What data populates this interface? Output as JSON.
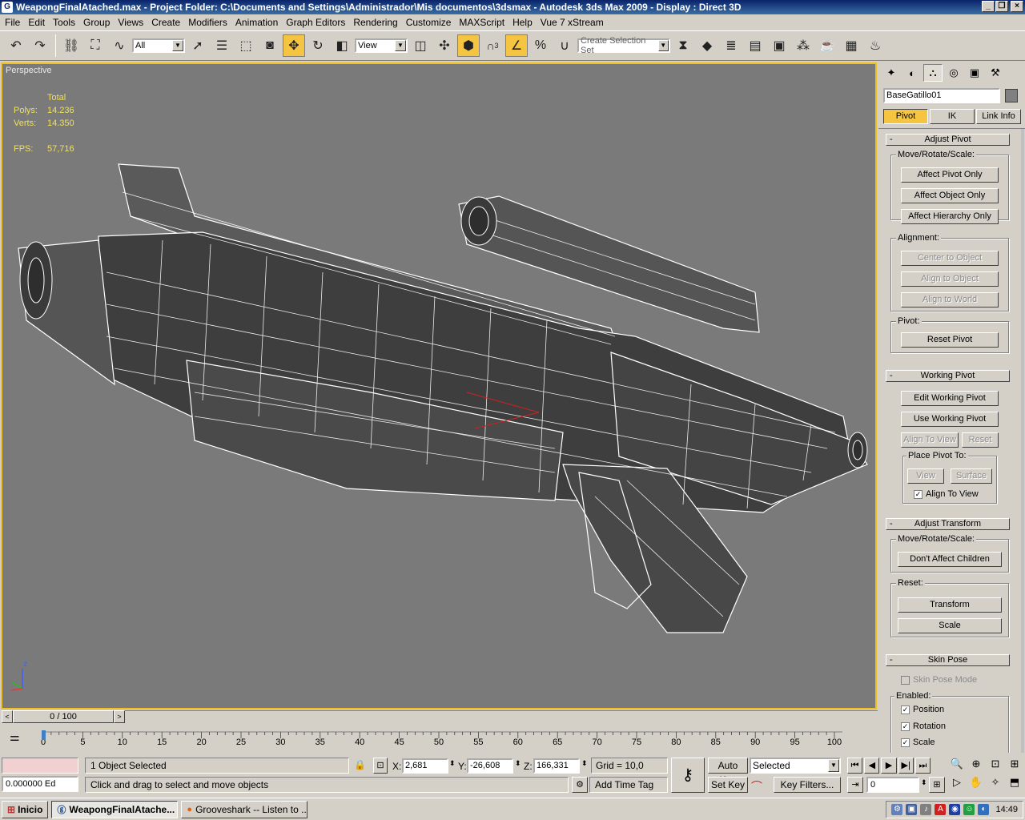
{
  "window": {
    "title": "WeapongFinalAtached.max    - Project Folder: C:\\Documents and Settings\\Administrador\\Mis documentos\\3dsmax    - Autodesk 3ds Max  2009      - Display : Direct 3D",
    "minimize": "_",
    "restore": "❐",
    "close": "×"
  },
  "menu": [
    "File",
    "Edit",
    "Tools",
    "Group",
    "Views",
    "Create",
    "Modifiers",
    "Animation",
    "Graph Editors",
    "Rendering",
    "Customize",
    "MAXScript",
    "Help",
    "Vue 7 xStream"
  ],
  "toolbar": {
    "selection_filter": "All",
    "reference_coord": "View",
    "named_selection_placeholder": "Create Selection Set",
    "snap_label": "3"
  },
  "viewport": {
    "label": "Perspective",
    "stats": {
      "header": "Total",
      "polys_label": "Polys:",
      "polys_value": "14.236",
      "verts_label": "Verts:",
      "verts_value": "14.350",
      "fps_label": "FPS:",
      "fps_value": "57,716"
    },
    "axis_z": "z"
  },
  "timeslider": {
    "frame": "0 / 100",
    "prev": "<",
    "next": ">"
  },
  "ruler": {
    "ticks": [
      "0",
      "5",
      "10",
      "15",
      "20",
      "25",
      "30",
      "35",
      "40",
      "45",
      "50",
      "55",
      "60",
      "65",
      "70",
      "75",
      "80",
      "85",
      "90",
      "95",
      "100"
    ]
  },
  "status": {
    "selection": "1 Object Selected",
    "prompt": "Click and drag to select and move objects",
    "x_label": "X:",
    "x_value": "2,681",
    "y_label": "Y:",
    "y_value": "-26,608",
    "z_label": "Z:",
    "z_value": "166,331",
    "grid": "Grid = 10,0",
    "add_time_tag": "Add Time Tag",
    "auto_key": "Auto Key",
    "set_key": "Set Key",
    "key_mode": "Selected",
    "key_filters": "Key Filters...",
    "current_frame": "0",
    "maxscript_value": "0.000000  Ed"
  },
  "command_panel": {
    "object_name": "BaseGatillo01",
    "sub_tabs": [
      "Pivot",
      "IK",
      "Link Info"
    ],
    "adjust_pivot": {
      "header": "Adjust Pivot",
      "move_group": "Move/Rotate/Scale:",
      "affect_pivot_only": "Affect Pivot Only",
      "affect_object_only": "Affect Object Only",
      "affect_hierarchy_only": "Affect Hierarchy Only",
      "alignment_group": "Alignment:",
      "center_to_object": "Center to Object",
      "align_to_object": "Align to Object",
      "align_to_world": "Align to World",
      "pivot_group": "Pivot:",
      "reset_pivot": "Reset Pivot"
    },
    "working_pivot": {
      "header": "Working Pivot",
      "edit_working_pivot": "Edit Working Pivot",
      "use_working_pivot": "Use Working Pivot",
      "align_to_view": "Align To View",
      "reset": "Reset",
      "place_pivot_group": "Place Pivot To:",
      "view": "View",
      "surface": "Surface",
      "align_to_view_check": "Align To View"
    },
    "adjust_transform": {
      "header": "Adjust Transform",
      "move_group": "Move/Rotate/Scale:",
      "dont_affect_children": "Don't Affect Children",
      "reset_group": "Reset:",
      "transform": "Transform",
      "scale": "Scale"
    },
    "skin_pose": {
      "header": "Skin Pose",
      "skin_pose_mode": "Skin Pose Mode",
      "enabled_group": "Enabled:",
      "position": "Position",
      "rotation": "Rotation",
      "scale": "Scale"
    }
  },
  "taskbar": {
    "start": "Inicio",
    "tasks": [
      "WeapongFinalAtache...",
      "Grooveshark -- Listen to ..."
    ],
    "clock": "14:49"
  },
  "colors": {
    "viewport_bg": "#7a7a7a",
    "active_border": "#f0c020",
    "stats_text": "#f0e060",
    "active_button": "#f5c542"
  }
}
